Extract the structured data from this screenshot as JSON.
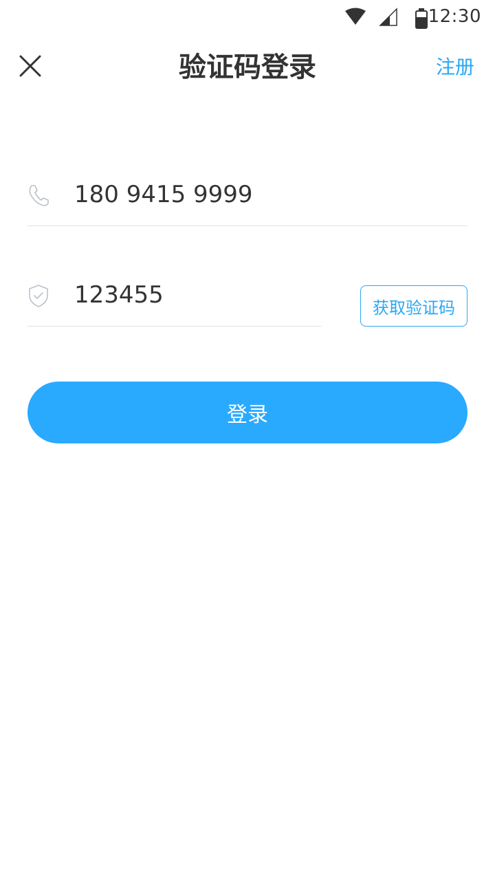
{
  "status_bar": {
    "time": "12:30",
    "icons": [
      "wifi-icon",
      "signal-icon",
      "battery-icon"
    ]
  },
  "header": {
    "title": "验证码登录",
    "close_icon": "close-icon",
    "register_label": "注册"
  },
  "form": {
    "phone": {
      "icon": "phone-icon",
      "value": "180 9415 9999"
    },
    "code": {
      "icon": "shield-check-icon",
      "value": "123455"
    },
    "get_code_label": "获取验证码",
    "login_label": "登录"
  },
  "colors": {
    "accent": "#29a8f4",
    "login_button": "#29aaff",
    "text": "#333333",
    "divider": "#e3e3e3"
  }
}
